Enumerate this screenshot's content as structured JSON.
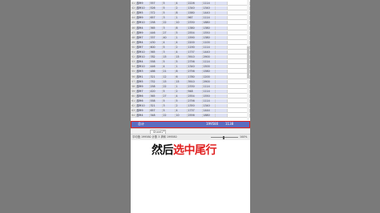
{
  "sheet": {
    "rows": [
      [
        "41",
        "部M9",
        "557",
        "5",
        "4",
        "2226",
        "1114"
      ],
      [
        "42",
        "部M10",
        "526",
        "5",
        "2",
        "1340",
        "1340"
      ],
      [
        "43",
        "部M5",
        "372",
        "5",
        "8",
        "1580",
        "1440"
      ],
      [
        "44",
        "部M9",
        "657",
        "3",
        "1",
        "967",
        "1114"
      ],
      [
        "45",
        "部M10",
        "258",
        "22",
        "10",
        "2330",
        "1880"
      ],
      [
        "46",
        "部M4",
        "365",
        "3",
        "8",
        "1380",
        "1380"
      ],
      [
        "47",
        "部M9",
        "446",
        "27",
        "5",
        "2554",
        "1550"
      ],
      [
        "48",
        "部M7",
        "337",
        "40",
        "1",
        "1590",
        "1380"
      ],
      [
        "49",
        "部M4",
        "430",
        "4",
        "4",
        "2200",
        "1100"
      ],
      [
        "50",
        "部M7",
        "600",
        "5",
        "2",
        "1190",
        "1114"
      ],
      [
        "51",
        "部M10",
        "365",
        "3",
        "4",
        "1737",
        "1440"
      ],
      [
        "52",
        "部M10",
        "782",
        "15",
        "15",
        "3910",
        "2900"
      ],
      [
        "53",
        "部M4",
        "558",
        "5",
        "5",
        "2756",
        "1114"
      ],
      [
        "54",
        "部M10",
        "446",
        "4",
        "1",
        "1340",
        "1500"
      ],
      [
        "55",
        "部M3",
        "486",
        "21",
        "8",
        "2756",
        "1580"
      ],
      [
        "56",
        "部M1",
        "321",
        "12",
        "6",
        "1780",
        "1200"
      ],
      [
        "57",
        "部M5",
        "752",
        "15",
        "15",
        "3910",
        "2900"
      ],
      [
        "58",
        "部M9",
        "258",
        "22",
        "1",
        "2330",
        "1114"
      ],
      [
        "59",
        "部M7",
        "420",
        "5",
        "2",
        "948",
        "1114"
      ],
      [
        "60",
        "部M6",
        "365",
        "27",
        "4",
        "2554",
        "1550"
      ],
      [
        "61",
        "部M6",
        "558",
        "5",
        "5",
        "2756",
        "1114"
      ],
      [
        "62",
        "部M10",
        "321",
        "3",
        "2",
        "1350",
        "1340"
      ],
      [
        "63",
        "部M9",
        "657",
        "5",
        "4",
        "1737",
        "1444"
      ],
      [
        "64",
        "部M4",
        "348",
        "22",
        "10",
        "2556",
        "1880"
      ]
    ]
  },
  "total_row": {
    "label": "总计",
    "value": "199580",
    "extra": "1138"
  },
  "tabs": {
    "active": "Sheet1",
    "add": "+"
  },
  "status": {
    "left": "平均值 199580  计数 3  求和 199580",
    "zoom": "100%"
  },
  "caption": {
    "part1": "然后",
    "part2": "选中尾行"
  },
  "colors": {
    "selection": "#dde1f5",
    "total_row_bg": "#5b6dc1",
    "highlight_border": "#e02020",
    "caption_accent": "#e02020"
  }
}
